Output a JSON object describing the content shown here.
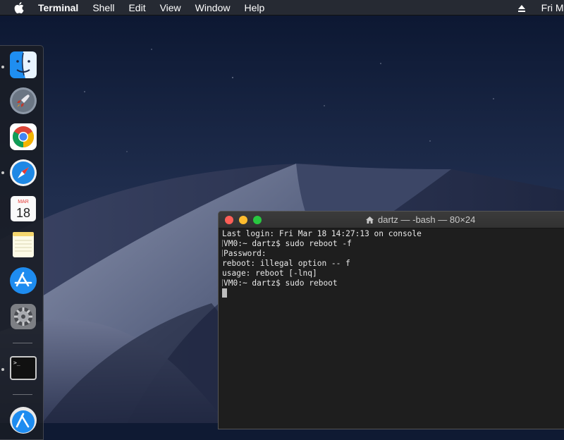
{
  "menubar": {
    "apple_icon": "apple-logo-icon",
    "app_name": "Terminal",
    "items": [
      "Shell",
      "Edit",
      "View",
      "Window",
      "Help"
    ],
    "clock": "Fri Mar",
    "eject_icon": "eject-icon"
  },
  "dock": {
    "items": [
      {
        "name": "finder",
        "icon": "finder-icon",
        "running": true
      },
      {
        "name": "launchpad",
        "icon": "launchpad-rocket-icon",
        "running": false
      },
      {
        "name": "chrome",
        "icon": "chrome-icon",
        "running": false
      },
      {
        "name": "safari",
        "icon": "safari-compass-icon",
        "running": true
      },
      {
        "name": "calendar",
        "icon": "calendar-icon",
        "running": false,
        "month": "MAR",
        "day": "18"
      },
      {
        "name": "notes",
        "icon": "notes-icon",
        "running": false
      },
      {
        "name": "app-store",
        "icon": "app-store-icon",
        "running": false
      },
      {
        "name": "system-preferences",
        "icon": "gear-icon",
        "running": false
      },
      {
        "name": "terminal",
        "icon": "terminal-icon",
        "running": true,
        "prompt": ">_"
      },
      {
        "name": "app-store-downloads",
        "icon": "app-store-icon",
        "running": false
      }
    ]
  },
  "terminal": {
    "title": "dartz — -bash — 80×24",
    "title_icon": "home-folder-icon",
    "lines": [
      "Last login: Fri Mar 18 14:27:13 on console",
      "VM0:~ dartz$ sudo reboot -f",
      "Password:",
      "reboot: illegal option -- f",
      "usage: reboot [-lnq]",
      "VM0:~ dartz$ sudo reboot"
    ]
  },
  "colors": {
    "menubar": "#262a33",
    "terminal_bg": "#1e1e1e",
    "close": "#fe5f57",
    "minimize": "#febc2e",
    "zoom": "#28c840"
  }
}
